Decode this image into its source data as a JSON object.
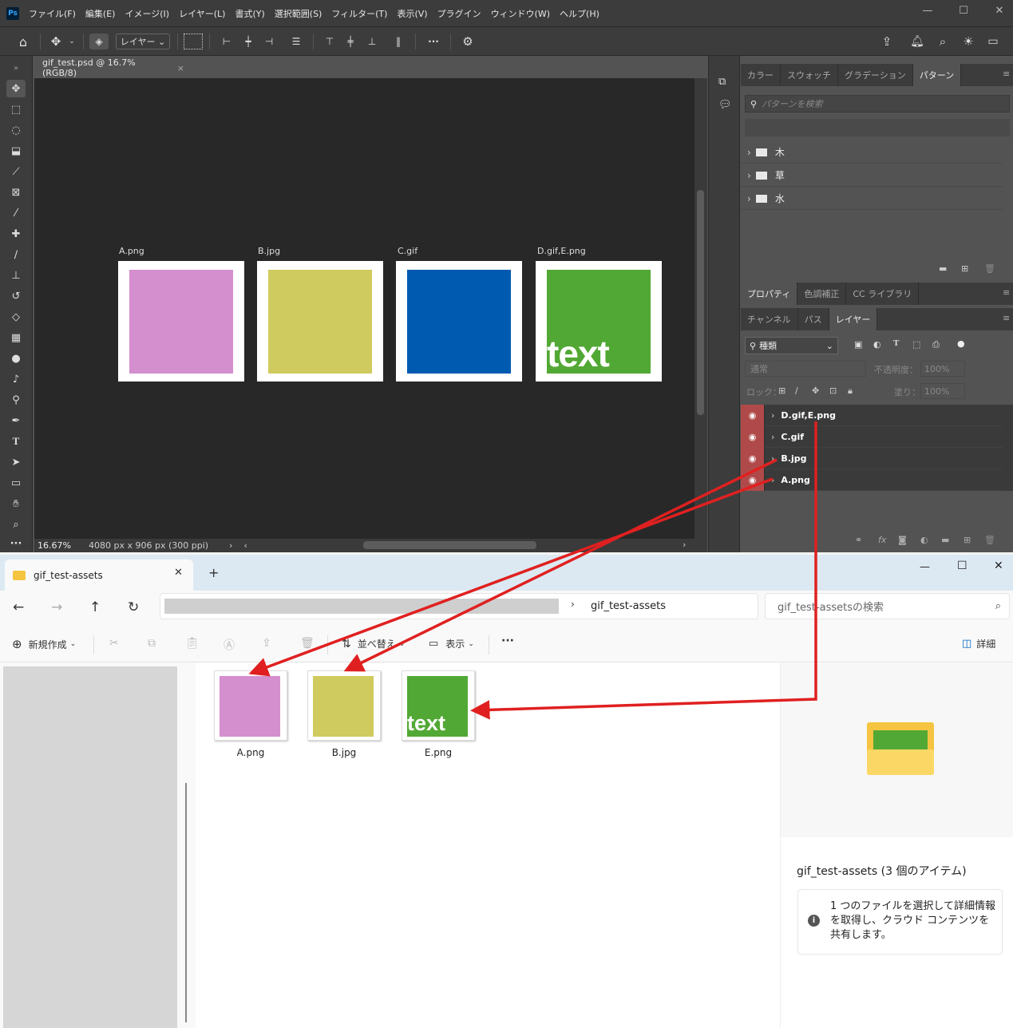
{
  "photoshop": {
    "logo": "Ps",
    "menu": [
      "ファイル(F)",
      "編集(E)",
      "イメージ(I)",
      "レイヤー(L)",
      "書式(Y)",
      "選択範囲(S)",
      "フィルター(T)",
      "表示(V)",
      "プラグイン",
      "ウィンドウ(W)",
      "ヘルプ(H)"
    ],
    "options": {
      "layer_select": "レイヤー"
    },
    "document_tab": "gif_test.psd @ 16.7% (RGB/8)",
    "artboards": [
      {
        "label": "A.png",
        "color": "#d48fce"
      },
      {
        "label": "B.jpg",
        "color": "#cfcb5e"
      },
      {
        "label": "C.gif",
        "color": "#005bb0"
      },
      {
        "label": "D.gif,E.png",
        "color": "#52a834",
        "overlay_text": "text"
      }
    ],
    "status": {
      "zoom": "16.67%",
      "doc_info": "4080 px x 906 px (300 ppi)"
    },
    "patterns_panel": {
      "tabs": [
        "カラー",
        "スウォッチ",
        "グラデーション",
        "パターン"
      ],
      "active_tab": "パターン",
      "search_placeholder": "パターンを検索",
      "groups": [
        "木",
        "草",
        "水"
      ]
    },
    "properties_tabs": [
      "プロパティ",
      "色調補正",
      "CC ライブラリ"
    ],
    "layers_panel": {
      "tabs": [
        "チャンネル",
        "パス",
        "レイヤー"
      ],
      "filter": "種類",
      "blend_mode": "通常",
      "opacity_label": "不透明度：",
      "opacity": "100%",
      "lock_label": "ロック：",
      "fill_label": "塗り：",
      "fill": "100%",
      "layers": [
        "D.gif,E.png",
        "C.gif",
        "B.jpg",
        "A.png"
      ]
    }
  },
  "explorer": {
    "tab_title": "gif_test-assets",
    "breadcrumb": "gif_test-assets",
    "search_placeholder": "gif_test-assetsの検索",
    "commands": {
      "new": "新規作成",
      "sort": "並べ替え",
      "view": "表示",
      "details": "詳細"
    },
    "files": [
      {
        "name": "A.png",
        "color": "#d48fce"
      },
      {
        "name": "B.jpg",
        "color": "#cfcb5e"
      },
      {
        "name": "E.png",
        "color": "#52a834",
        "overlay_text": "text"
      }
    ],
    "details": {
      "title": "gif_test-assets (3 個のアイテム)",
      "info": "1 つのファイルを選択して詳細情報を取得し、クラウド コンテンツを共有します。"
    }
  },
  "colors": {
    "arrow": "#e02020",
    "folder": "#f5c542"
  }
}
